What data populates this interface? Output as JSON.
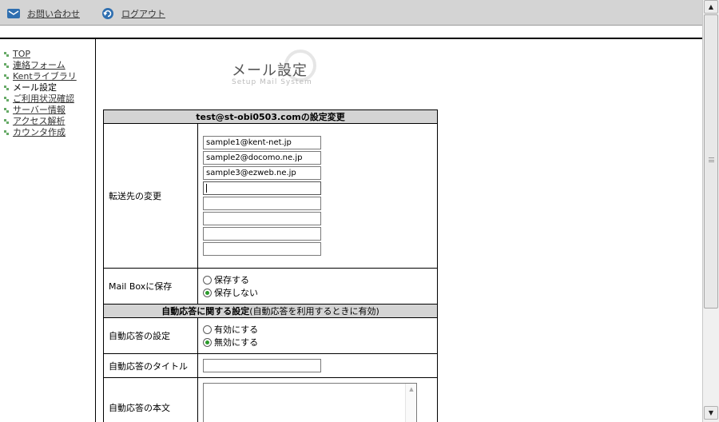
{
  "header": {
    "contact_label": "お問い合わせ",
    "logout_label": "ログアウト"
  },
  "sidebar": {
    "items": [
      {
        "label": "TOP",
        "current": false
      },
      {
        "label": "連絡フォーム",
        "current": false
      },
      {
        "label": "Kentライブラリ",
        "current": false
      },
      {
        "label": "メール設定",
        "current": true
      },
      {
        "label": "ご利用状況確認",
        "current": false
      },
      {
        "label": "サーバー情報",
        "current": false
      },
      {
        "label": "アクセス解析",
        "current": false
      },
      {
        "label": "カウンタ作成",
        "current": false
      }
    ]
  },
  "page": {
    "title": "メール設定",
    "subtitle": "Setup Mail System"
  },
  "settings": {
    "header": "test@st-obi0503.comの設定変更",
    "forward_label": "転送先の変更",
    "forward_addresses": [
      "sample1@kent-net.jp",
      "sample2@docomo.ne.jp",
      "sample3@ezweb.ne.jp",
      "",
      "",
      "",
      "",
      ""
    ],
    "mailbox_label": "Mail Boxに保存",
    "mailbox_options": [
      "保存する",
      "保存しない"
    ],
    "mailbox_selected": "保存しない"
  },
  "autoreply": {
    "header_bold": "自動応答に関する設定",
    "header_note": "(自動応答を利用するときに有効)",
    "setting_label": "自動応答の設定",
    "options": [
      "有効にする",
      "無効にする"
    ],
    "selected": "無効にする",
    "title_label": "自動応答のタイトル",
    "title_value": "",
    "body_label": "自動応答の本文",
    "body_value": ""
  },
  "colors": {
    "header_bg": "#d4d4d4",
    "bullet": "#66aa66",
    "radio_dot": "#2a9a2a"
  }
}
